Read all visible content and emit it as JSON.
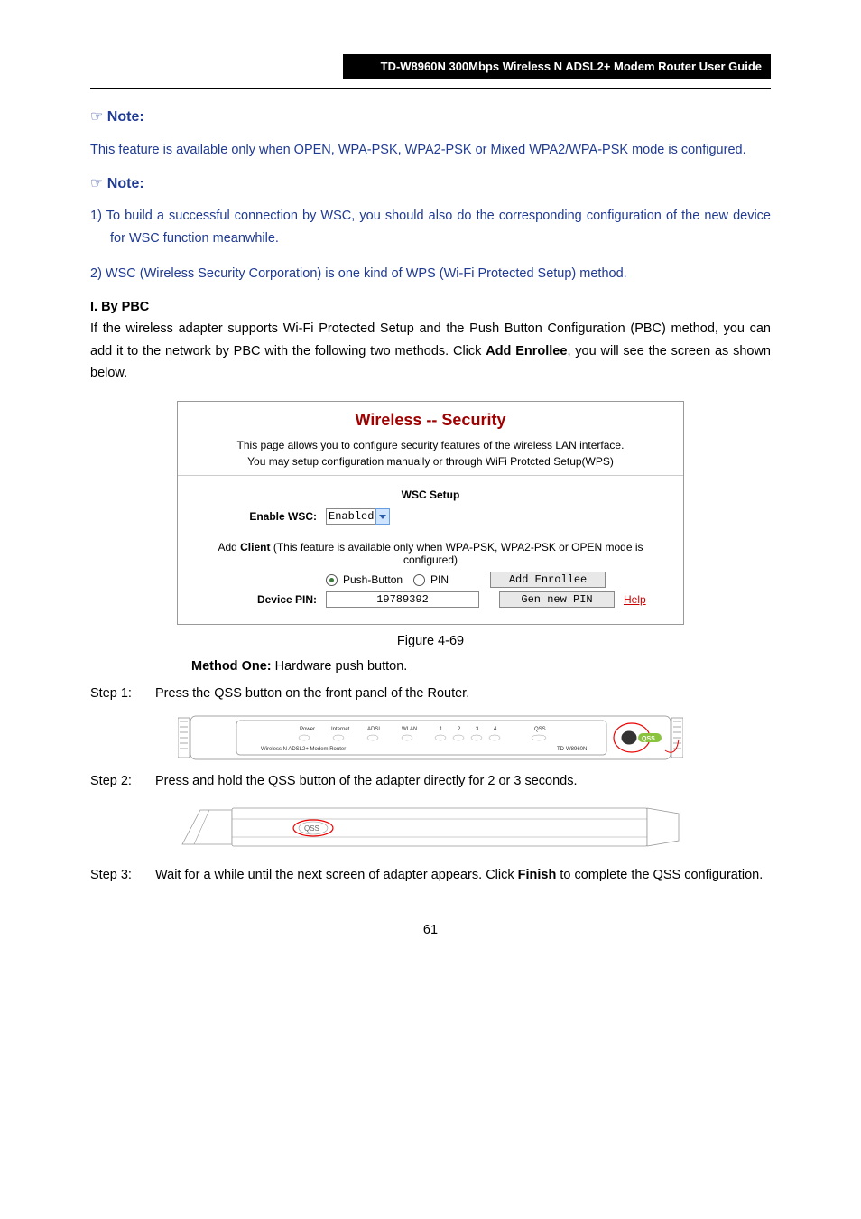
{
  "header": "TD-W8960N 300Mbps Wireless N ADSL2+ Modem Router User Guide",
  "notes": {
    "label": "Note:",
    "note1": "This feature is available only when OPEN, WPA-PSK, WPA2-PSK or Mixed WPA2/WPA-PSK mode is configured.",
    "note2_item1": "1)  To build a successful connection by WSC, you should also do the corresponding configuration of the new device for WSC function meanwhile.",
    "note2_item2": "2)  WSC (Wireless Security Corporation) is one kind of WPS (Wi-Fi Protected Setup) method."
  },
  "section": {
    "title_a": "I.  By PBC",
    "intro_a": "If the wireless adapter supports Wi-Fi Protected Setup and the Push Button Configuration (PBC) method, you can add it to the network by PBC with the following two methods. Click ",
    "intro_b": ", you will see the screen as shown below.",
    "add_enrollee_btn": "Add Enrollee"
  },
  "screenshot": {
    "title": "Wireless -- Security",
    "desc1": "This page allows you to configure security features of the wireless LAN interface.",
    "desc2": "You may setup configuration manually or through WiFi Protcted Setup(WPS)",
    "wsc_setup": "WSC Setup",
    "enable_wsc_label": "Enable WSC:",
    "enable_wsc_value": "Enabled",
    "add_client_prefix": "Add ",
    "add_client_bold": "Client",
    "add_client_suffix": " (This feature is available only when WPA-PSK, WPA2-PSK or OPEN mode is configured)",
    "push_button": "Push-Button",
    "pin": "PIN",
    "add_enrollee_btn": "Add Enrollee",
    "device_pin_label": "Device PIN:",
    "device_pin_value": "19789392",
    "gen_new_pin": "Gen new PIN",
    "help": "Help"
  },
  "figure_caption": "Figure 4-69",
  "method": {
    "title": "Method One:",
    "subtitle": " Hardware push button.",
    "step1_label": "Step 1:",
    "step1_text": "Press the QSS button on the front panel of the Router.",
    "step2_label": "Step 2:",
    "step2_text": "Press and hold the QSS button of the adapter directly for 2 or 3 seconds.",
    "step3_label": "Step 3:",
    "step3_a": "Wait for a while until the next screen of adapter appears. Click ",
    "step3_bold": "Finish",
    "step3_b": " to complete the QSS configuration."
  },
  "router": {
    "labels": [
      "Power",
      "Internet",
      "ADSL",
      "WLAN",
      "1",
      "2",
      "3",
      "4",
      "QSS"
    ],
    "model_left": "Wireless N ADSL2+ Modem Router",
    "model_right": "TD-W8960N",
    "qss_btn": "QSS"
  },
  "adapter": {
    "qss": "QSS"
  },
  "page_number": "61"
}
